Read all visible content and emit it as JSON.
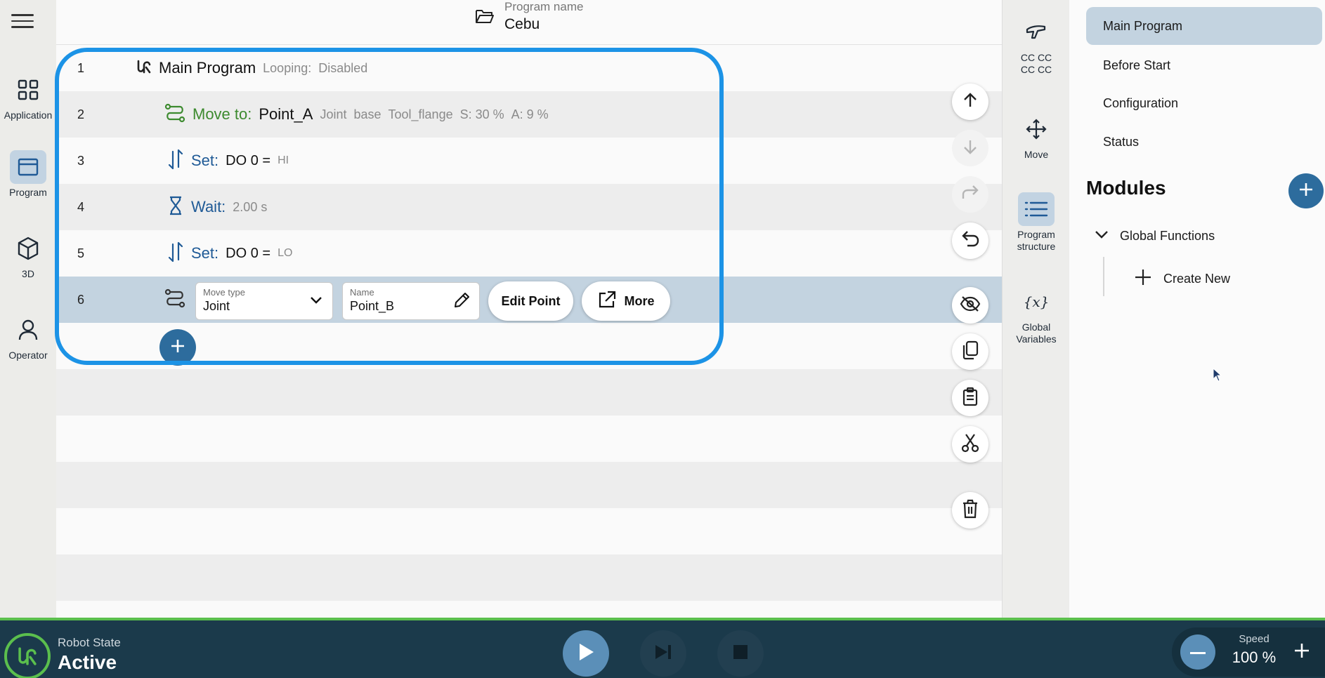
{
  "nav": {
    "items": [
      {
        "label": "Application",
        "icon": "grid-icon"
      },
      {
        "label": "Program",
        "icon": "window-icon",
        "active": true
      },
      {
        "label": "3D",
        "icon": "cube-icon"
      },
      {
        "label": "Operator",
        "icon": "person-icon"
      }
    ]
  },
  "header": {
    "program_name_caption": "Program name",
    "program_name": "Cebu"
  },
  "program": {
    "rows": [
      {
        "num": "1",
        "title": "Main Program",
        "looping_label": "Looping:",
        "looping_value": "Disabled"
      },
      {
        "num": "2",
        "keyword": "Move to:",
        "target": "Point_A",
        "details": [
          "Joint",
          "base",
          "Tool_flange",
          "S: 30 %",
          "A: 9 %"
        ]
      },
      {
        "num": "3",
        "keyword": "Set:",
        "target": "DO 0 =",
        "value": "HI"
      },
      {
        "num": "4",
        "keyword": "Wait:",
        "value": "2.00 s"
      },
      {
        "num": "5",
        "keyword": "Set:",
        "target": "DO 0 =",
        "value": "LO"
      },
      {
        "num": "6",
        "move_type_caption": "Move type",
        "move_type_value": "Joint",
        "name_caption": "Name",
        "name_value": "Point_B",
        "edit_point_label": "Edit Point",
        "more_label": "More"
      }
    ]
  },
  "tools": {
    "items": [
      {
        "label": "CC CC\nCC CC",
        "icon": "freedrive-icon"
      },
      {
        "label": "Move",
        "icon": "move-arrows-icon"
      },
      {
        "label": "Program\nstructure",
        "icon": "list-icon",
        "active": true
      },
      {
        "label": "Global\nVariables",
        "icon": "variable-icon",
        "glyph": "{x}"
      }
    ]
  },
  "right_panel": {
    "items": [
      {
        "label": "Main Program",
        "active": true
      },
      {
        "label": "Before Start"
      },
      {
        "label": "Configuration"
      },
      {
        "label": "Status"
      }
    ],
    "modules_title": "Modules",
    "tree": {
      "group": "Global Functions",
      "create_new": "Create New"
    }
  },
  "bottom": {
    "robot_state_caption": "Robot State",
    "robot_state_value": "Active",
    "speed_caption": "Speed",
    "speed_value": "100 %"
  },
  "colors": {
    "accent_blue": "#2d6c9d",
    "highlight_border": "#1c93e6",
    "move_green": "#3c8a2e",
    "keyword_blue": "#1f5a96",
    "bottombar": "#1b3a4b",
    "status_green": "#5bbf4d",
    "selected_row": "#c3d3e0"
  }
}
